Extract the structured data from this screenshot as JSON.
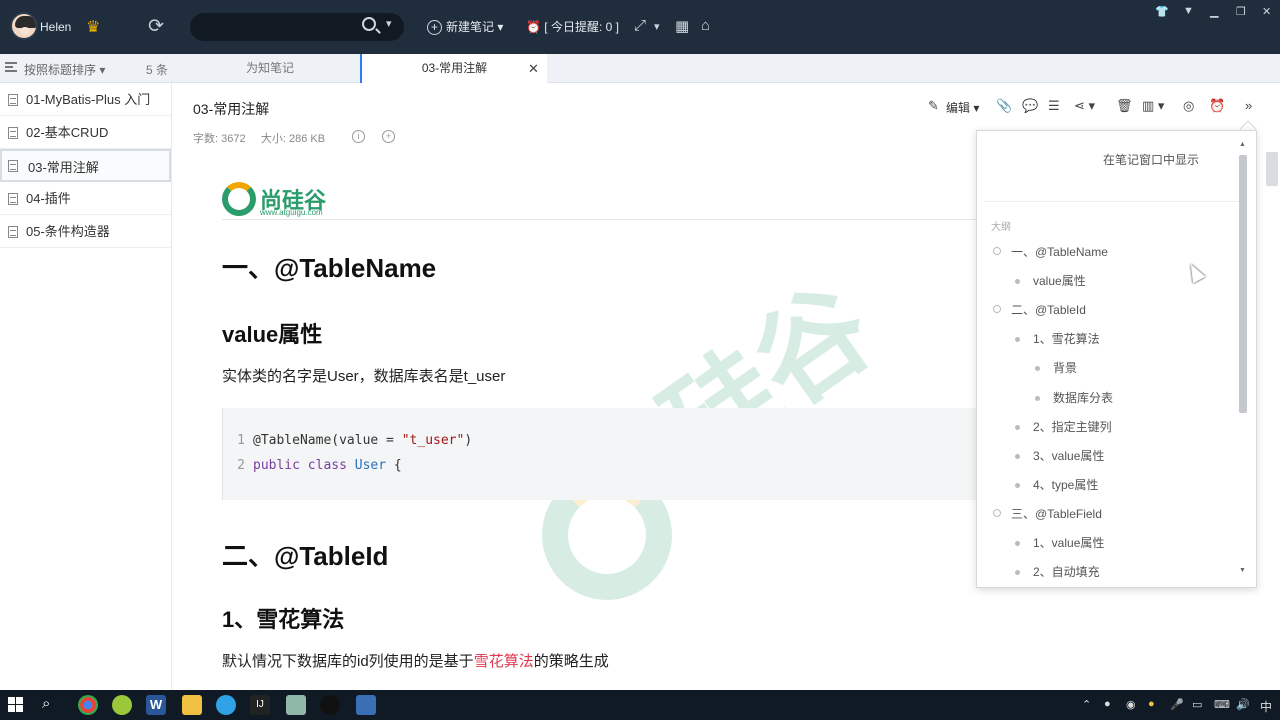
{
  "user": {
    "name": "Helen"
  },
  "topbar": {
    "new_note": "新建笔记",
    "reminder": "[ 今日提醒: 0 ]"
  },
  "sortbar": {
    "label": "按照标题排序",
    "count": "5 条"
  },
  "tabs": [
    {
      "label": "为知笔记"
    },
    {
      "label": "03-常用注解"
    }
  ],
  "notes": [
    {
      "label": "01-MyBatis-Plus 入门"
    },
    {
      "label": "02-基本CRUD"
    },
    {
      "label": "03-常用注解"
    },
    {
      "label": "04-插件"
    },
    {
      "label": "05-条件构造器"
    }
  ],
  "note": {
    "title": "03-常用注解",
    "meta": "字数: 3672     大小: 286 KB",
    "edit_label": "编辑"
  },
  "content": {
    "logo_text": "尚硅谷",
    "logo_sub": "www.atguigu.com",
    "h1_a": "一、@TableName",
    "h2_a": "value属性",
    "para_a": "实体类的名字是User，数据库表名是t_user",
    "code": {
      "line1_no": "1",
      "line1_a": "@TableName(value = ",
      "line1_str": "\"t_user\"",
      "line1_b": ")",
      "line2_no": "2",
      "line2_kw": "public class ",
      "line2_cls": "User",
      "line2_b": " {"
    },
    "h1_b": "二、@TableId",
    "h2_b": "1、雪花算法",
    "para_b_pre": "默认情况下数据库的id列使用的是基于",
    "para_b_hl": "雪花算法",
    "para_b_post": "的策略生成",
    "watermark": "硅谷"
  },
  "outline": {
    "show_in_window": "在笔记窗口中显示",
    "label": "大纲",
    "items": [
      {
        "text": "一、@TableName",
        "level": 1
      },
      {
        "text": "value属性",
        "level": 2
      },
      {
        "text": "二、@TableId",
        "level": 1
      },
      {
        "text": "1、雪花算法",
        "level": 2
      },
      {
        "text": "背景",
        "level": 3
      },
      {
        "text": "数据库分表",
        "level": 3
      },
      {
        "text": "2、指定主键列",
        "level": 2
      },
      {
        "text": "3、value属性",
        "level": 2
      },
      {
        "text": "4、type属性",
        "level": 2
      },
      {
        "text": "三、@TableField",
        "level": 1
      },
      {
        "text": "1、value属性",
        "level": 2
      },
      {
        "text": "2、自动填充",
        "level": 2
      }
    ]
  },
  "taskbar": {
    "ime": "中"
  }
}
